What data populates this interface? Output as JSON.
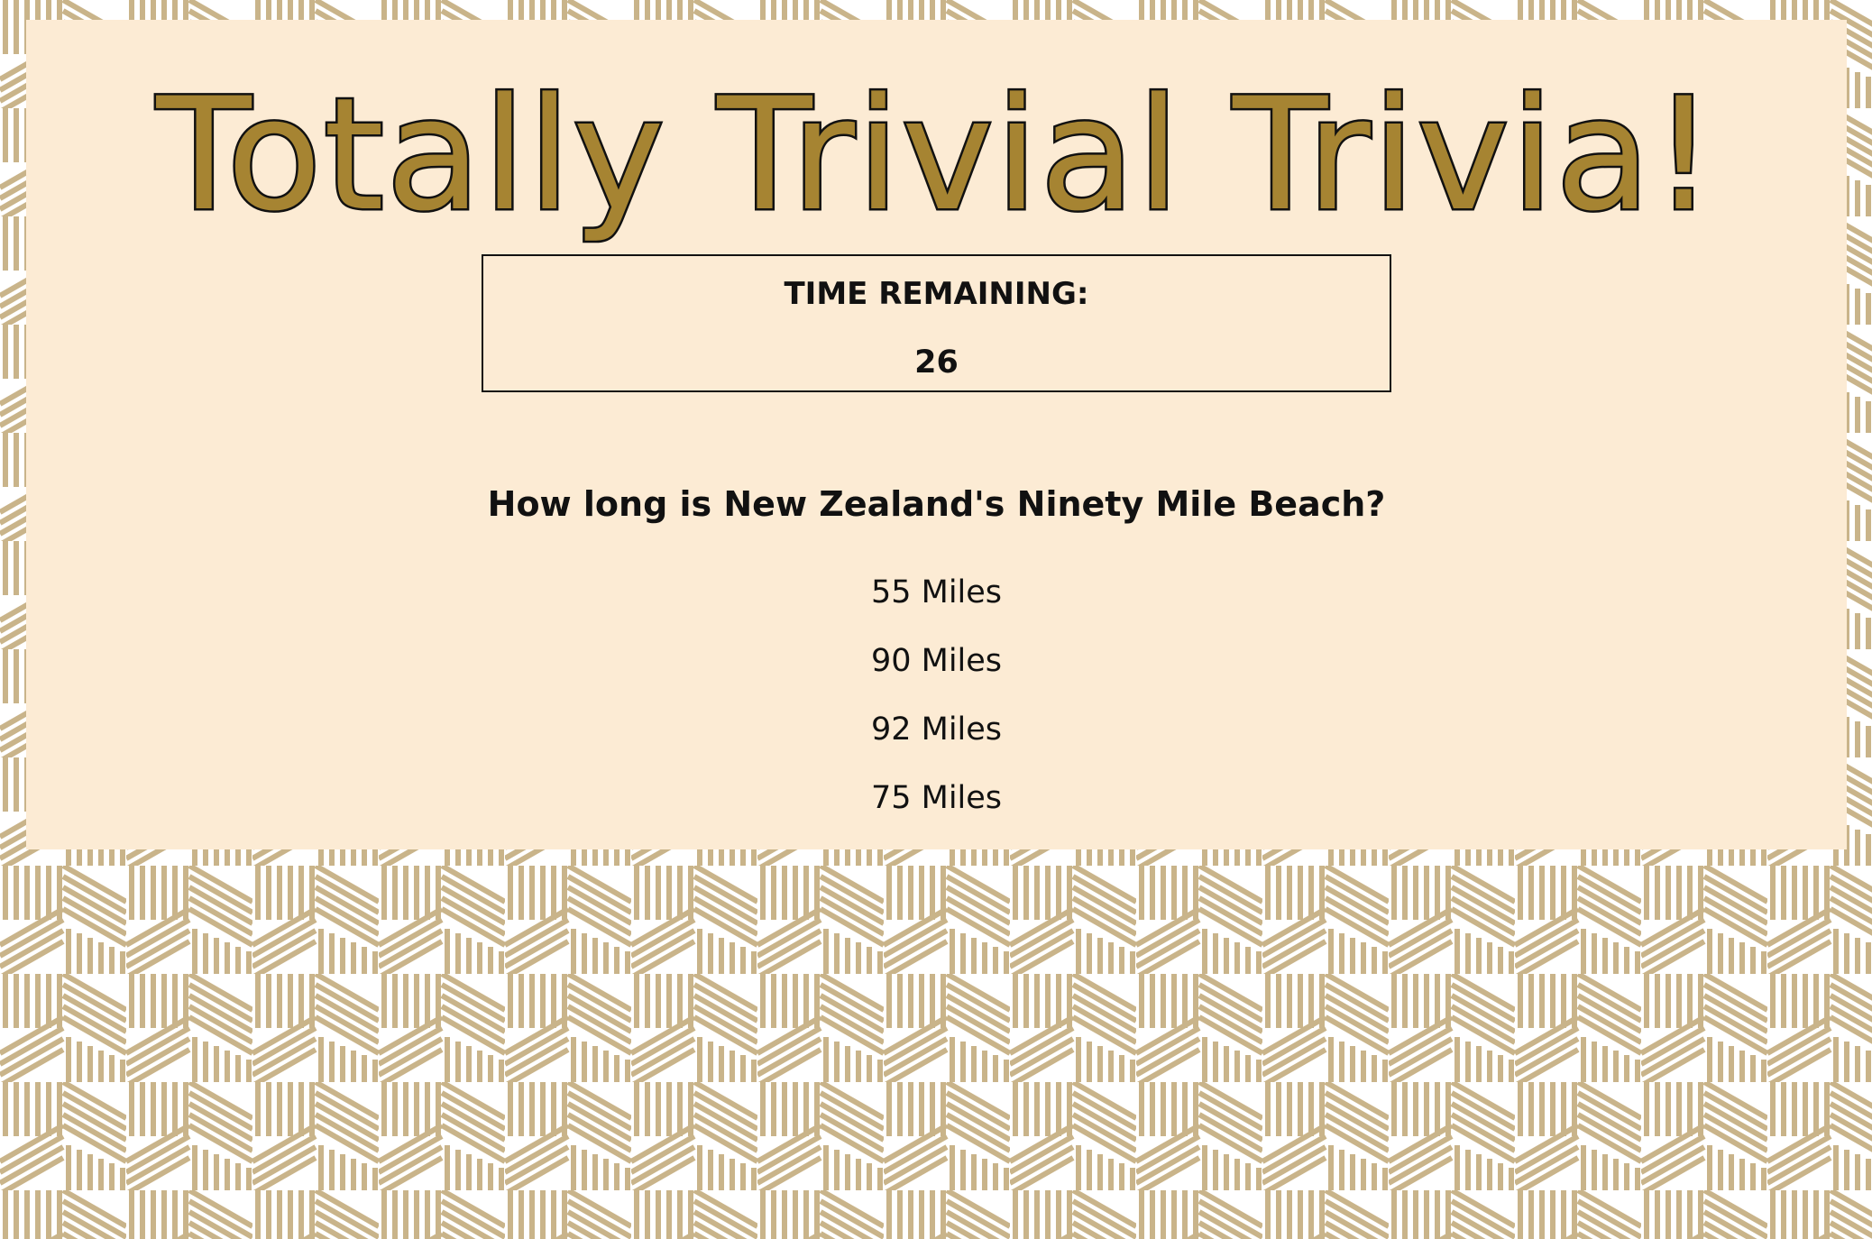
{
  "app": {
    "title": "Totally Trivial Trivia!"
  },
  "timer": {
    "label": "TIME REMAINING:",
    "value": "26"
  },
  "quiz": {
    "question": "How long is New Zealand's Ninety Mile Beach?",
    "answers": [
      "55 Miles",
      "90 Miles",
      "92 Miles",
      "75 Miles"
    ]
  },
  "colors": {
    "panel_background": "#fcebd4",
    "title_fill": "#a68432",
    "title_outline": "#111111",
    "pattern_stripes": "#c9b48a",
    "text": "#111111"
  }
}
